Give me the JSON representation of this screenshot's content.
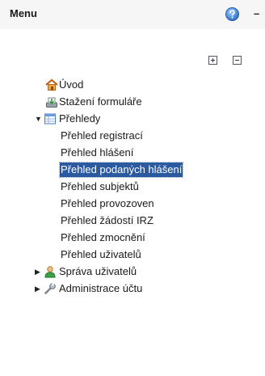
{
  "header": {
    "title": "Menu",
    "minimize_label": "–"
  },
  "toolbar": {
    "expand_all": "plus",
    "collapse_all": "minus"
  },
  "tree": {
    "uvod": "Úvod",
    "stazeni": "Stažení formuláře",
    "prehledy": "Přehledy",
    "prehledy_children": [
      "Přehled registrací",
      "Přehled hlášení",
      "Přehled podaných hlášení",
      "Přehled subjektů",
      "Přehled provozoven",
      "Přehled žádostí IRZ",
      "Přehled zmocnění",
      "Přehled uživatelů"
    ],
    "sprava": "Správa uživatelů",
    "administrace": "Administrace účtu"
  },
  "colors": {
    "selection": "#2c5aa0",
    "header_bg": "#f6f6f6"
  }
}
